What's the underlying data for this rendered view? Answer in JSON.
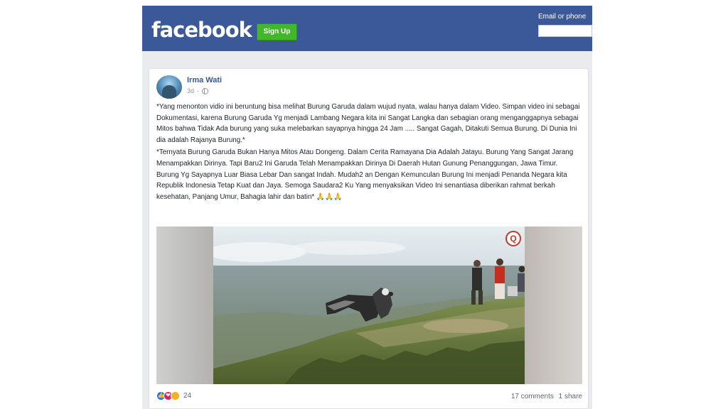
{
  "header": {
    "logo": "facebook",
    "signup_label": "Sign Up",
    "login_label": "Email or phone",
    "email_value": ""
  },
  "post": {
    "author": "Irma Wati",
    "time": "3d",
    "paragraphs": [
      "*Yang menonton vidio ini beruntung bisa melihat Burung Garuda dalam wujud nyata, walau hanya dalam Video. Simpan video ini sebagai Dokumentasi, karena Burung Garuda Yg menjadi Lambang Negara kita ini Sangat Langka dan sebagian orang menganggapnya sebagai Mitos bahwa Tidak Ada burung yang suka melebarkan sayapnya hingga 24 Jam ..... Sangat Gagah, Ditakuti Semua Burung. Di Dunia Ini dia adalah Rajanya Burung.*",
      "*Ternyata Burung Garuda Bukan Hanya Mitos Atau Dongeng. Dalam Cerita Ramayana Dia Adalah Jatayu. Burung Yang Sangat Jarang Menampakkan Dirinya. Tapi Baru2 Ini Garuda Telah Menampakkan Dirinya Di Daerah Hutan Gunung Penanggungan, Jawa Timur. Burung Yg Sayapnya Luar Biasa Lebar Dan sangat Indah. Mudah2 an Dengan Kemunculan Burung Ini menjadi Penanda Negara kita Republik Indonesia Tetap Kuat dan Jaya. Semoga Saudara2 Ku Yang menyaksikan Video Ini senantiasa diberikan rahmat berkah kesehatan, Panjang Umur, Bahagia lahir dan batin* 🙏🙏🙏"
    ],
    "reactions_count": "24",
    "comments": "17 comments",
    "shares": "1 share"
  },
  "colors": {
    "brand": "#3b5998",
    "signup": "#42b72a",
    "link": "#365899"
  }
}
